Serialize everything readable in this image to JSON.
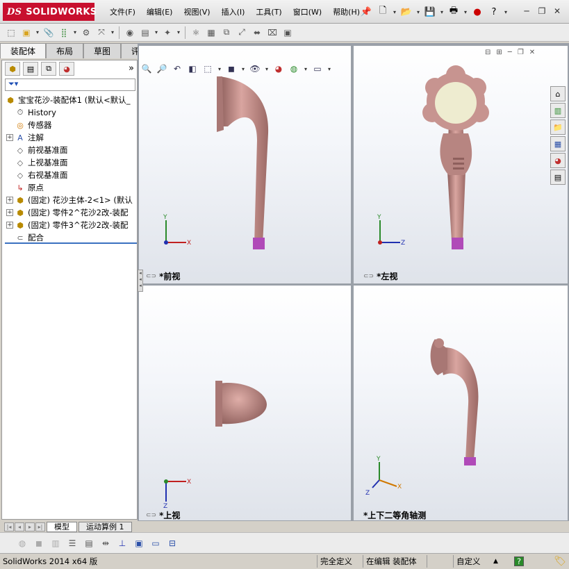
{
  "app": {
    "logo_prefix": "DS",
    "logo_text": "SOLIDWORKS"
  },
  "menus": [
    "文件(F)",
    "编辑(E)",
    "视图(V)",
    "插入(I)",
    "工具(T)",
    "窗口(W)",
    "帮助(H)"
  ],
  "left_tabs": [
    "装配体",
    "布局",
    "草图",
    "评估"
  ],
  "tree": {
    "root": "宝宝花沙-装配体1  (默认<默认_",
    "items": [
      {
        "label": "History",
        "icon": "history-icon",
        "exp": false
      },
      {
        "label": "传感器",
        "icon": "sensor-icon",
        "exp": false
      },
      {
        "label": "注解",
        "icon": "annotation-icon",
        "exp": true
      },
      {
        "label": "前视基准面",
        "icon": "plane-icon",
        "exp": false
      },
      {
        "label": "上视基准面",
        "icon": "plane-icon",
        "exp": false
      },
      {
        "label": "右视基准面",
        "icon": "plane-icon",
        "exp": false
      },
      {
        "label": "原点",
        "icon": "origin-icon",
        "exp": false
      },
      {
        "label": "(固定) 花沙主体-2<1> (默认",
        "icon": "part-icon",
        "exp": true
      },
      {
        "label": "(固定) 零件2^花沙2改-装配",
        "icon": "part-icon",
        "exp": true
      },
      {
        "label": "(固定) 零件3^花沙2改-装配",
        "icon": "part-icon",
        "exp": true
      },
      {
        "label": "配合",
        "icon": "mate-icon",
        "exp": false
      }
    ]
  },
  "viewports": [
    {
      "label": "*前视",
      "axes": [
        "Y",
        "X"
      ]
    },
    {
      "label": "*左视",
      "axes": [
        "Y",
        "Z"
      ]
    },
    {
      "label": "*上视",
      "axes": [
        "X",
        "Z"
      ]
    },
    {
      "label": "*上下二等角轴测",
      "axes": [
        "Y",
        "X",
        "Z"
      ]
    }
  ],
  "bottom_tabs": [
    "模型",
    "运动算例 1"
  ],
  "status": {
    "app_version": "SolidWorks 2014 x64 版",
    "definition": "完全定义",
    "editing": "在编辑 装配体",
    "units": "自定义",
    "up_arrow": "▲",
    "help": "?"
  },
  "colors": {
    "brand": "#c8102e",
    "model": "#c9938e",
    "grip": "#b04ab8"
  }
}
